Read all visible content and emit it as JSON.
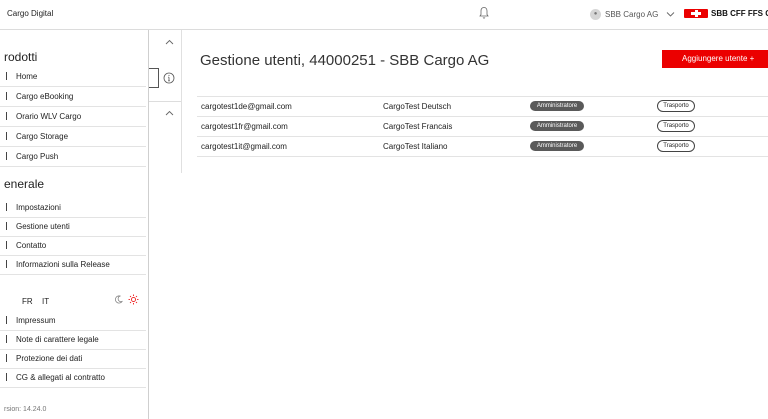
{
  "header": {
    "app_name": "Cargo Digital",
    "account_label": "SBB Cargo AG",
    "brand_text": "SBB CFF FFS Ca"
  },
  "sidebar": {
    "products_title": "rodotti",
    "products": [
      {
        "label": "Home"
      },
      {
        "label": "Cargo eBooking"
      },
      {
        "label": "Orario WLV Cargo"
      },
      {
        "label": "Cargo Storage"
      },
      {
        "label": "Cargo Push"
      }
    ],
    "general_title": "enerale",
    "general": [
      {
        "label": "Impostazioni"
      },
      {
        "label": "Gestione utenti"
      },
      {
        "label": "Contatto"
      },
      {
        "label": "Informazioni sulla Release"
      }
    ],
    "languages": [
      "FR",
      "IT"
    ],
    "legal": [
      {
        "label": "Impressum"
      },
      {
        "label": "Note di carattere legale"
      },
      {
        "label": "Protezione dei dati"
      },
      {
        "label": "CG & allegati al contratto"
      }
    ],
    "version": "rsion: 14.24.0"
  },
  "main": {
    "title": "Gestione utenti, 44000251 - SBB Cargo AG",
    "add_button_label": "Aggiungere utente +",
    "users": [
      {
        "email": "cargotest1de@gmail.com",
        "name": "CargoTest Deutsch",
        "role": "Amministratore",
        "tag": "Trasporto"
      },
      {
        "email": "cargotest1fr@gmail.com",
        "name": "CargoTest Francais",
        "role": "Amministratore",
        "tag": "Trasporto"
      },
      {
        "email": "cargotest1it@gmail.com",
        "name": "CargoTest Italiano",
        "role": "Amministratore",
        "tag": "Trasporto"
      }
    ]
  },
  "colors": {
    "accent": "#eb0000",
    "badge": "#5a5a5a"
  },
  "icons": [
    "bell-icon",
    "avatar-icon",
    "chevron-down-icon",
    "sbb-logo-icon",
    "chevron-up-icon",
    "info-icon",
    "moon-icon",
    "sun-icon"
  ]
}
